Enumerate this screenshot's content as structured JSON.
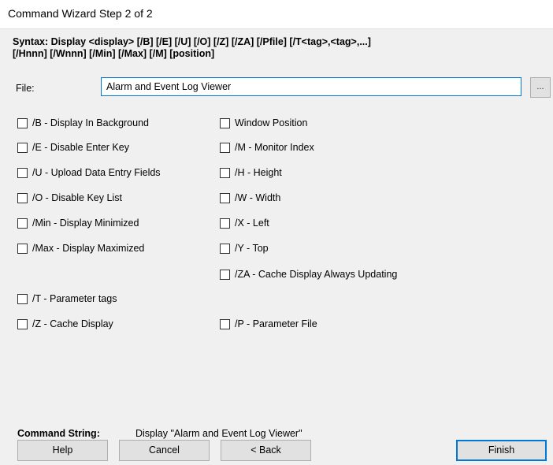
{
  "window": {
    "title": "Command Wizard Step 2 of 2"
  },
  "syntax": {
    "line1": "Syntax: Display <display> [/B] [/E] [/U] [/O] [/Z] [/ZA] [/Pfile] [/T<tag>,<tag>,...]",
    "line2": "[/Hnnn] [/Wnnn] [/Min] [/Max] [/M] [position]"
  },
  "file": {
    "label": "File:",
    "value": "Alarm and Event Log Viewer",
    "browse_label": "..."
  },
  "options_left": [
    {
      "label": "/B - Display In Background",
      "checked": false
    },
    {
      "label": "/E - Disable Enter Key",
      "checked": false
    },
    {
      "label": "/U - Upload Data Entry Fields",
      "checked": false
    },
    {
      "label": "/O - Disable Key List",
      "checked": false
    },
    {
      "label": "/Min - Display Minimized",
      "checked": false
    },
    {
      "label": "/Max - Display Maximized",
      "checked": false
    },
    {
      "label": "/T - Parameter tags",
      "checked": false
    },
    {
      "label": "/Z - Cache Display",
      "checked": false
    }
  ],
  "options_right": [
    {
      "label": "Window Position",
      "checked": false
    },
    {
      "label": "/M - Monitor Index",
      "checked": false
    },
    {
      "label": "/H - Height",
      "checked": false
    },
    {
      "label": "/W - Width",
      "checked": false
    },
    {
      "label": "/X - Left",
      "checked": false
    },
    {
      "label": "/Y - Top",
      "checked": false
    },
    {
      "label": "/ZA - Cache Display Always Updating",
      "checked": false
    },
    {
      "label": "/P - Parameter File",
      "checked": false
    }
  ],
  "command": {
    "label": "Command String:",
    "value": "Display \"Alarm and Event Log Viewer\""
  },
  "buttons": {
    "help": "Help",
    "cancel": "Cancel",
    "back": "< Back",
    "finish": "Finish"
  }
}
